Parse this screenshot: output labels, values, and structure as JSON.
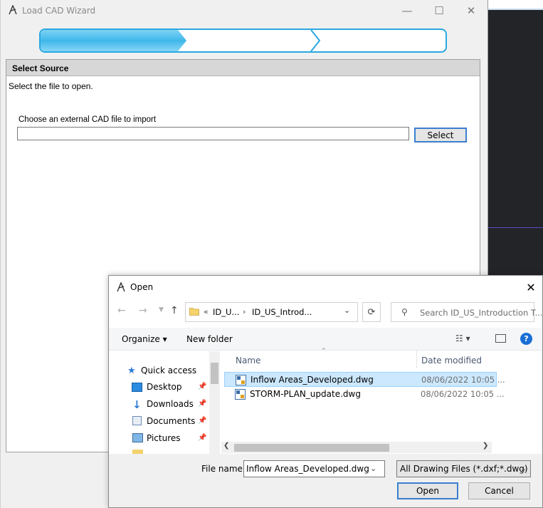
{
  "wizard": {
    "title": "Load CAD Wizard",
    "progress_fraction": 0.36,
    "panel_header": "Select Source",
    "description": "Select the file to open.",
    "choose_label": "Choose an external CAD file to import",
    "path_value": "",
    "select_label": "Select",
    "window_controls": {
      "minimize": "—",
      "maximize": "☐",
      "close": "✕"
    }
  },
  "dialog": {
    "title": "Open",
    "close_glyph": "✕",
    "address": {
      "sep": "«",
      "crumb1": "ID_U...",
      "sep2": "›",
      "crumb2": "ID_US_Introd..."
    },
    "search_placeholder": "Search ID_US_Introduction T...",
    "toolbar": {
      "organize": "Organize ▾",
      "new_folder": "New folder",
      "view": "☷ ▾",
      "help": "?"
    },
    "nav_items": [
      {
        "label": "Quick access",
        "icon": "star-icon"
      },
      {
        "label": "Desktop",
        "icon": "desktop-icon"
      },
      {
        "label": "Downloads",
        "icon": "download-icon"
      },
      {
        "label": "Documents",
        "icon": "document-icon"
      },
      {
        "label": "Pictures",
        "icon": "picture-icon"
      }
    ],
    "pin_glyph": "📌",
    "columns": {
      "name": "Name",
      "date": "Date modified"
    },
    "files": [
      {
        "name": "Inflow Areas_Developed.dwg",
        "date": "08/06/2022 10:05 ...",
        "selected": true
      },
      {
        "name": "STORM-PLAN_update.dwg",
        "date": "08/06/2022 10:05 ...",
        "selected": false
      }
    ],
    "file_name_label": "File name:",
    "file_name_value": "Inflow Areas_Developed.dwg",
    "filter_value": "All Drawing Files (*.dxf;*.dwg)",
    "open_label": "Open",
    "cancel_label": "Cancel"
  },
  "colors": {
    "accent": "#29a8e0",
    "selection": "#cce8ff",
    "focus_border": "#3a7fd0"
  }
}
